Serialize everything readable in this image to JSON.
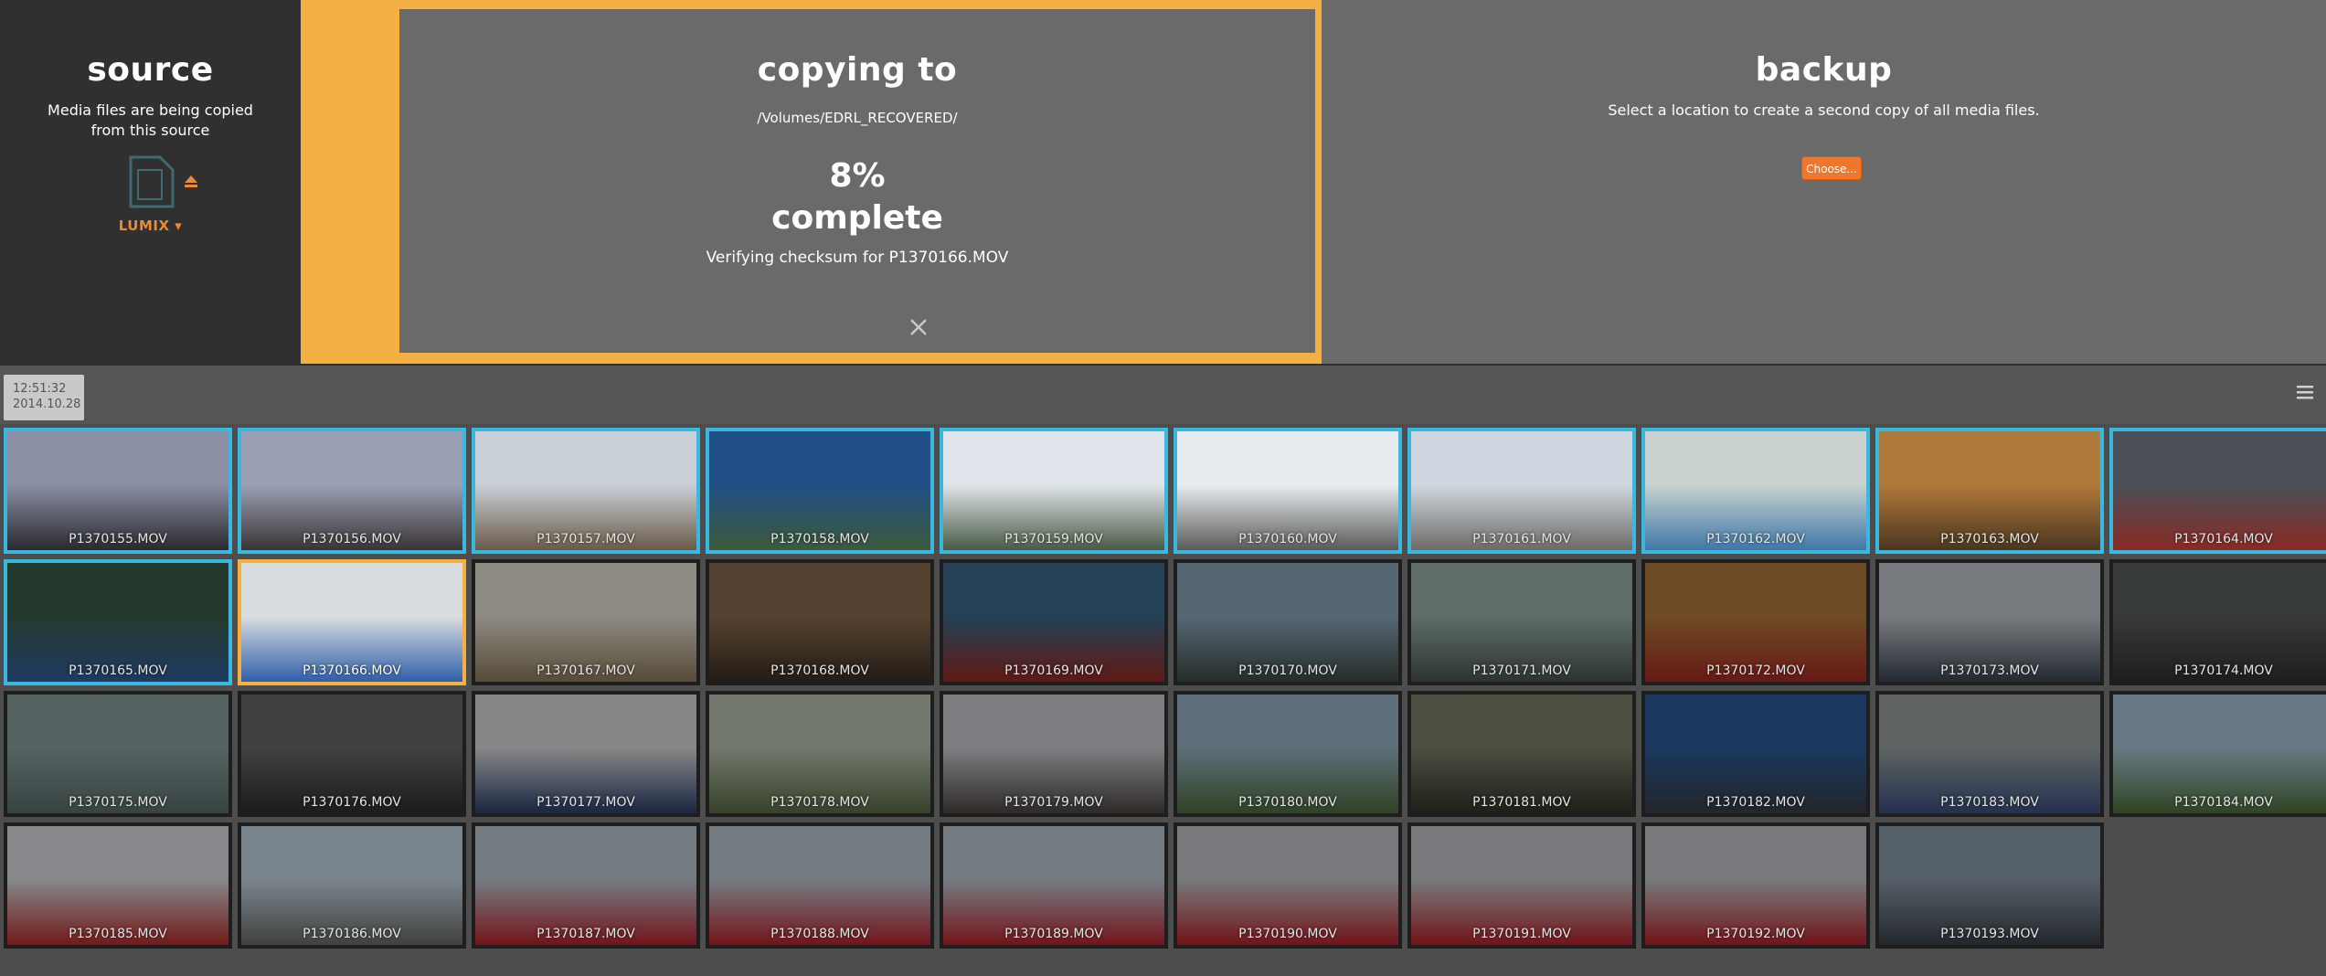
{
  "source": {
    "title": "source",
    "description": "Media files are being copied from this source",
    "device_name": "LUMIX ▾",
    "icon": "sd-card-icon",
    "eject_icon": "eject-icon"
  },
  "copying": {
    "title": "copying to",
    "path": "/Volumes/EDRL_RECOVERED/",
    "percent": "8%",
    "percent_value": 8,
    "complete_label": "complete",
    "status": "Verifying checksum for P1370166.MOV",
    "cancel_icon": "close-icon"
  },
  "backup": {
    "title": "backup",
    "description": "Select a location to create a second copy of all media files.",
    "choose_label": "Choose..."
  },
  "bar": {
    "time": "12:51:32",
    "date": "2014.10.28",
    "menu_icon": "hamburger-menu-icon"
  },
  "colors": {
    "accent_orange": "#f5b043",
    "button_orange": "#f0762c",
    "copied_blue": "#3bb8df",
    "source_bg": "#303030",
    "panel_bg": "#6a6a6a"
  },
  "files": [
    {
      "name": "P1370155.MOV",
      "state": "copied",
      "c1": "#8a8fa3",
      "c2": "#2a2a2e"
    },
    {
      "name": "P1370156.MOV",
      "state": "copied",
      "c1": "#9aa0b4",
      "c2": "#3a3434"
    },
    {
      "name": "P1370157.MOV",
      "state": "copied",
      "c1": "#c9cfd6",
      "c2": "#6a5a48"
    },
    {
      "name": "P1370158.MOV",
      "state": "copied",
      "c1": "#1f4f86",
      "c2": "#3e5a3a"
    },
    {
      "name": "P1370159.MOV",
      "state": "copied",
      "c1": "#dfe4ea",
      "c2": "#4a5a44"
    },
    {
      "name": "P1370160.MOV",
      "state": "copied",
      "c1": "#e8ecef",
      "c2": "#5a5a5a"
    },
    {
      "name": "P1370161.MOV",
      "state": "copied",
      "c1": "#cfd8e0",
      "c2": "#6e6a66"
    },
    {
      "name": "P1370162.MOV",
      "state": "copied",
      "c1": "#c9d2cf",
      "c2": "#3f78a8"
    },
    {
      "name": "P1370163.MOV",
      "state": "copied",
      "c1": "#b07a3a",
      "c2": "#4a3620"
    },
    {
      "name": "P1370164.MOV",
      "state": "copied",
      "c1": "#4a4f58",
      "c2": "#8a2a24"
    },
    {
      "name": "P1370165.MOV",
      "state": "copied",
      "c1": "#243a2e",
      "c2": "#1e3a62"
    },
    {
      "name": "P1370166.MOV",
      "state": "active",
      "c1": "#d9dde0",
      "c2": "#2f5fa8"
    },
    {
      "name": "P1370167.MOV",
      "state": "pending",
      "c1": "#e6e0d2",
      "c2": "#8c7a5a"
    },
    {
      "name": "P1370168.MOV",
      "state": "pending",
      "c1": "#8a6a4c",
      "c2": "#3a2e26"
    },
    {
      "name": "P1370169.MOV",
      "state": "pending",
      "c1": "#3a6a8a",
      "c2": "#9a2a22"
    },
    {
      "name": "P1370170.MOV",
      "state": "pending",
      "c1": "#8aa6b8",
      "c2": "#3e4a44"
    },
    {
      "name": "P1370171.MOV",
      "state": "pending",
      "c1": "#9ab0a6",
      "c2": "#4a544e"
    },
    {
      "name": "P1370172.MOV",
      "state": "pending",
      "c1": "#b07a3a",
      "c2": "#a82a22"
    },
    {
      "name": "P1370173.MOV",
      "state": "pending",
      "c1": "#c0c6cc",
      "c2": "#3c4450"
    },
    {
      "name": "P1370174.MOV",
      "state": "pending",
      "c1": "#5a5e5e",
      "c2": "#2e3232"
    },
    {
      "name": "P1370175.MOV",
      "state": "pending",
      "c1": "#8aa0a0",
      "c2": "#5a6e6a"
    },
    {
      "name": "P1370176.MOV",
      "state": "pending",
      "c1": "#6a6a6a",
      "c2": "#2e2e2e"
    },
    {
      "name": "P1370177.MOV",
      "state": "pending",
      "c1": "#dadada",
      "c2": "#2a3e6a"
    },
    {
      "name": "P1370178.MOV",
      "state": "pending",
      "c1": "#b8c2b0",
      "c2": "#5a6a44"
    },
    {
      "name": "P1370179.MOV",
      "state": "pending",
      "c1": "#c8ccd0",
      "c2": "#4a4440"
    },
    {
      "name": "P1370180.MOV",
      "state": "pending",
      "c1": "#98b4c4",
      "c2": "#4e6a3c"
    },
    {
      "name": "P1370181.MOV",
      "state": "pending",
      "c1": "#7a8068",
      "c2": "#30342a"
    },
    {
      "name": "P1370182.MOV",
      "state": "pending",
      "c1": "#2a5a9a",
      "c2": "#3a3e44"
    },
    {
      "name": "P1370183.MOV",
      "state": "pending",
      "c1": "#9aa0a0",
      "c2": "#3a5080"
    },
    {
      "name": "P1370184.MOV",
      "state": "pending",
      "c1": "#a6c4d2",
      "c2": "#4e6e3a"
    },
    {
      "name": "P1370185.MOV",
      "state": "pending",
      "c1": "#d8dce0",
      "c2": "#b82a2a"
    },
    {
      "name": "P1370186.MOV",
      "state": "pending",
      "c1": "#c6d6e4",
      "c2": "#6a6a66"
    },
    {
      "name": "P1370187.MOV",
      "state": "pending",
      "c1": "#bcc8d2",
      "c2": "#b8222a"
    },
    {
      "name": "P1370188.MOV",
      "state": "pending",
      "c1": "#bcc8d2",
      "c2": "#b8222a"
    },
    {
      "name": "P1370189.MOV",
      "state": "pending",
      "c1": "#bcc8d2",
      "c2": "#b8222a"
    },
    {
      "name": "P1370190.MOV",
      "state": "pending",
      "c1": "#c0c4c8",
      "c2": "#b8222a"
    },
    {
      "name": "P1370191.MOV",
      "state": "pending",
      "c1": "#c0c4c8",
      "c2": "#b8222a"
    },
    {
      "name": "P1370192.MOV",
      "state": "pending",
      "c1": "#c0c4c8",
      "c2": "#b8222a"
    },
    {
      "name": "P1370193.MOV",
      "state": "pending",
      "c1": "#8a9aa8",
      "c2": "#3a4048"
    }
  ]
}
